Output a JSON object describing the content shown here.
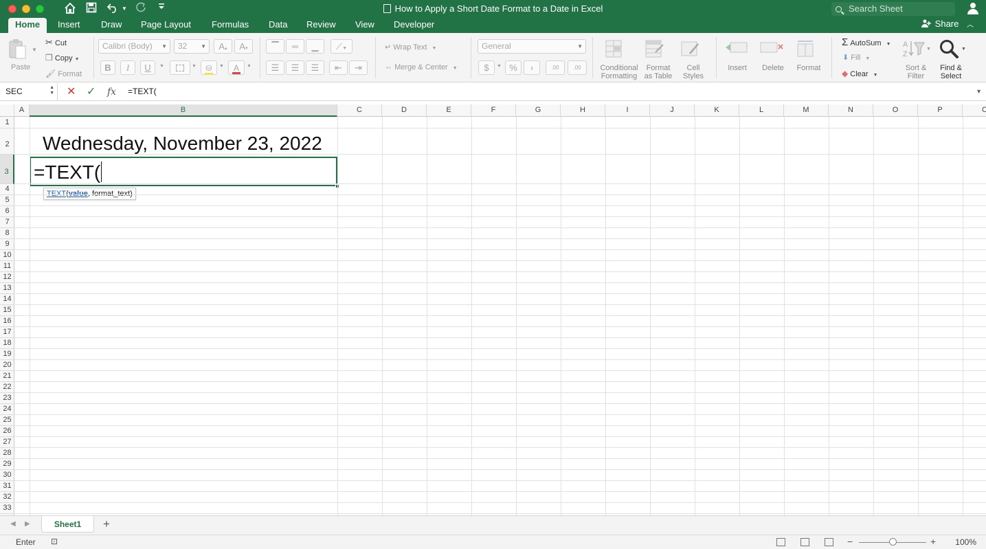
{
  "window": {
    "title": "How to Apply a Short Date Format to a Date in Excel",
    "search_placeholder": "Search Sheet",
    "share_label": "Share"
  },
  "tabs": [
    "Home",
    "Insert",
    "Draw",
    "Page Layout",
    "Formulas",
    "Data",
    "Review",
    "View",
    "Developer"
  ],
  "ribbon": {
    "clipboard": {
      "paste": "Paste",
      "cut": "Cut",
      "copy": "Copy",
      "format": "Format"
    },
    "font": {
      "name": "Calibri (Body)",
      "size": "32",
      "bold": "B",
      "italic": "I",
      "underline": "U"
    },
    "alignment": {
      "wrap_text": "Wrap Text",
      "merge_center": "Merge & Center"
    },
    "number": {
      "format": "General",
      "currency": "$",
      "percent": "%",
      "comma": "›",
      "inc_decimal": ".00",
      "dec_decimal": ".00"
    },
    "styles": {
      "conditional_formatting_1": "Conditional",
      "conditional_formatting_2": "Formatting",
      "format_table_1": "Format",
      "format_table_2": "as Table",
      "cell_styles_1": "Cell",
      "cell_styles_2": "Styles"
    },
    "cells": {
      "insert": "Insert",
      "delete": "Delete",
      "format": "Format"
    },
    "editing": {
      "autosum": "AutoSum",
      "fill": "Fill",
      "clear": "Clear",
      "sort_filter_1": "Sort &",
      "sort_filter_2": "Filter",
      "find_select_1": "Find &",
      "find_select_2": "Select"
    }
  },
  "formula_bar": {
    "name_box": "SEC",
    "formula": "=TEXT("
  },
  "grid": {
    "columns": [
      "A",
      "B",
      "C",
      "D",
      "E",
      "F",
      "G",
      "H",
      "I",
      "J",
      "K",
      "L",
      "M",
      "N",
      "O",
      "P",
      "C"
    ],
    "rows": [
      "1",
      "2",
      "3",
      "4",
      "5",
      "6",
      "7",
      "8",
      "9",
      "10",
      "11",
      "12",
      "13",
      "14",
      "15",
      "16",
      "17",
      "18",
      "19",
      "20",
      "21",
      "22",
      "23",
      "24",
      "25",
      "26",
      "27",
      "28",
      "29",
      "30",
      "31",
      "32",
      "33"
    ],
    "selected_column": "B",
    "selected_row": "3",
    "cell_b2": "Wednesday, November 23, 2022",
    "cell_b3": "=TEXT(",
    "tooltip": {
      "function": "TEXT",
      "open": "(",
      "arg1": "value",
      "rest": ", format_text)"
    }
  },
  "sheets": {
    "active": "Sheet1"
  },
  "status": {
    "mode": "Enter",
    "zoom": "100%"
  },
  "colors": {
    "accent": "#217346"
  }
}
